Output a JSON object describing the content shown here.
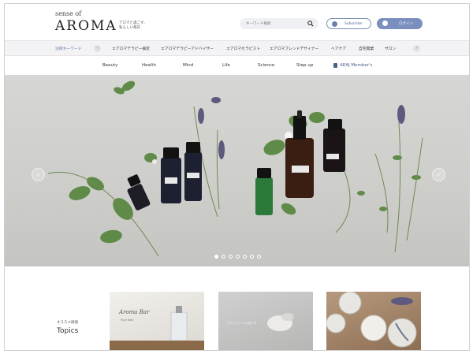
{
  "header": {
    "logo_small": "sense of",
    "logo_big": "AROMA",
    "tagline": "アロマと過ごす、 私らしい毎日",
    "search_placeholder": "キーワード検索",
    "subscribe_label": "Subscribe",
    "login_label": "ログイン"
  },
  "nav_primary": {
    "items": [
      {
        "label": "注目キーワード"
      },
      {
        "label": "エアロマテラピー検定"
      },
      {
        "label": "エアロマテラピーアドバイザー"
      },
      {
        "label": "エアロマセラピスト"
      },
      {
        "label": "エアロマブレンドデザイナー"
      },
      {
        "label": "ヘアケア"
      },
      {
        "label": "自宅開業"
      },
      {
        "label": "サロン"
      }
    ]
  },
  "nav_secondary": {
    "items": [
      {
        "label": "Beauty"
      },
      {
        "label": "Health"
      },
      {
        "label": "Mind"
      },
      {
        "label": "Life"
      },
      {
        "label": "Science"
      },
      {
        "label": "Step up"
      }
    ],
    "members_label": "AEAJ Member's"
  },
  "hero": {
    "dot_count": 7,
    "active_index": 0
  },
  "topics": {
    "subtitle": "オススメ情報",
    "title": "Topics",
    "cards": [
      {
        "title": "Aroma Bar",
        "subtitle": "Pure Rain"
      },
      {
        "caption": "アロマストーンの使い方"
      },
      {
        "caption": ""
      }
    ]
  },
  "colors": {
    "accent": "#7b8fbf",
    "nav_highlight": "#5a6fa0"
  }
}
